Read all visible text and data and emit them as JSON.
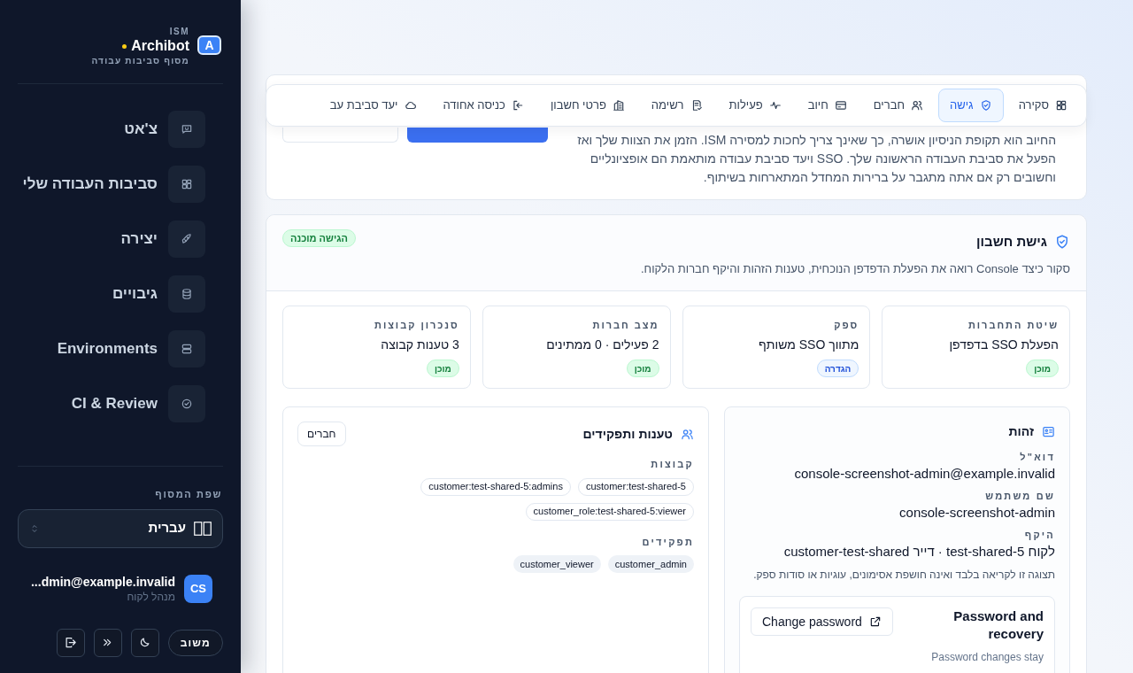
{
  "sidebar": {
    "brand": {
      "logo_letter": "A",
      "eyebrow": "ISM",
      "name": "Archibot",
      "subtitle": "מסוף סביבות עבודה"
    },
    "nav": [
      {
        "label": "צ'אט"
      },
      {
        "label": "סביבות העבודה שלי"
      },
      {
        "label": "יצירה"
      },
      {
        "label": "גיבויים"
      },
      {
        "label": "Environments"
      },
      {
        "label": "CI & Review"
      }
    ],
    "language": {
      "label": "שפת המסוף",
      "value": "עברית"
    },
    "user": {
      "initials": "CS",
      "email": "...dmin@example.invalid",
      "role": "מנהל לקוח"
    },
    "feedback_button": "משוב"
  },
  "tabs": [
    {
      "label": "סקירה",
      "selected": false
    },
    {
      "label": "גישה",
      "selected": true
    },
    {
      "label": "חברים",
      "selected": false
    },
    {
      "label": "חיוב",
      "selected": false
    },
    {
      "label": "פעילות",
      "selected": false
    },
    {
      "label": "רשימה",
      "selected": false
    },
    {
      "label": "פרטי חשבון",
      "selected": false
    },
    {
      "label": "כניסה אחודה",
      "selected": false
    },
    {
      "label": "יעד סביבת עב",
      "selected": false
    }
  ],
  "intro_card": {
    "text": "החיוב הוא תקופת הניסיון אושרה, כך שאינך צריך לחכות למסירה ISM. הזמן את הצוות שלך ואז הפעל את סביבת העבודה הראשונה שלך. SSO ויעד סביבת עבודה מותאמת הם אופציונליים וחשובים רק אם אתה מתגבר על ברירות המחדל המתארחות בשיתוף."
  },
  "access_card": {
    "title": "גישת חשבון",
    "description": "סקור כיצד Console רואה את הפעלת הדפדפן הנוכחית, טענות הזהות והיקף חברות הלקוח.",
    "status_badge": "הגישה מוכנה",
    "stats": [
      {
        "label": "שיטת התחברות",
        "value": "הפעלת SSO בדפדפן",
        "badge": "מוכן",
        "kind": "ready"
      },
      {
        "label": "ספק",
        "value": "מתווך SSO משותף",
        "badge": "הגדרה",
        "kind": "setup"
      },
      {
        "label": "מצב חברות",
        "value": "2 פעילים · 0 ממתינים",
        "badge": "מוכן",
        "kind": "ready"
      },
      {
        "label": "סנכרון קבוצות",
        "value": "3 טענות קבוצה",
        "badge": "מוכן",
        "kind": "ready"
      }
    ],
    "identity": {
      "title": "זהות",
      "fields": [
        {
          "label": "דוא\"ל",
          "value": "console-screenshot-admin@example.invalid"
        },
        {
          "label": "שם משתמש",
          "value": "console-screenshot-admin"
        },
        {
          "label": "היקף",
          "value": "לקוח test-shared-5 · דייר customer-test-shared"
        }
      ],
      "note": "תצוגה זו לקריאה בלבד ואינה חושפת אסימונים, עוגיות או סודות ספק.",
      "password": {
        "title": "Password and recovery",
        "button": "Change password",
        "description": "Password changes stay"
      }
    },
    "claims": {
      "title": "טענות ותפקידים",
      "button": "חברים",
      "groups_label": "קבוצות",
      "groups": [
        "customer:test-shared-5",
        "customer:test-shared-5:admins",
        "customer_role:test-shared-5:viewer"
      ],
      "roles_label": "תפקידים",
      "roles": [
        "customer_admin",
        "customer_viewer"
      ]
    }
  }
}
